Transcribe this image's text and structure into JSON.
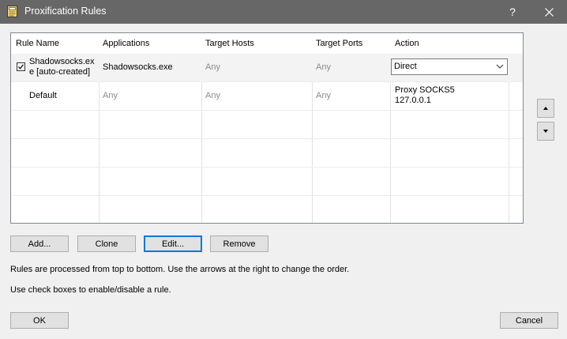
{
  "window": {
    "title": "Proxification Rules",
    "help_label": "?"
  },
  "table": {
    "columns": [
      "Rule Name",
      "Applications",
      "Target Hosts",
      "Target Ports",
      "Action"
    ],
    "rows": [
      {
        "checked": true,
        "rule_name_line1": "Shadowsocks.ex",
        "rule_name_line2": "e [auto-created]",
        "applications": "Shadowsocks.exe",
        "target_hosts": "Any",
        "target_ports": "Any",
        "action": "Direct"
      },
      {
        "rule_name": "Default",
        "applications": "Any",
        "target_hosts": "Any",
        "target_ports": "Any",
        "action_line1": "Proxy SOCKS5",
        "action_line2": "127.0.0.1"
      }
    ]
  },
  "buttons": {
    "add": "Add...",
    "clone": "Clone",
    "edit": "Edit...",
    "remove": "Remove",
    "ok": "OK",
    "cancel": "Cancel"
  },
  "info": {
    "line1": "Rules are processed from top to bottom. Use the arrows at the right to change the order.",
    "line2": "Use check boxes to enable/disable a rule."
  }
}
